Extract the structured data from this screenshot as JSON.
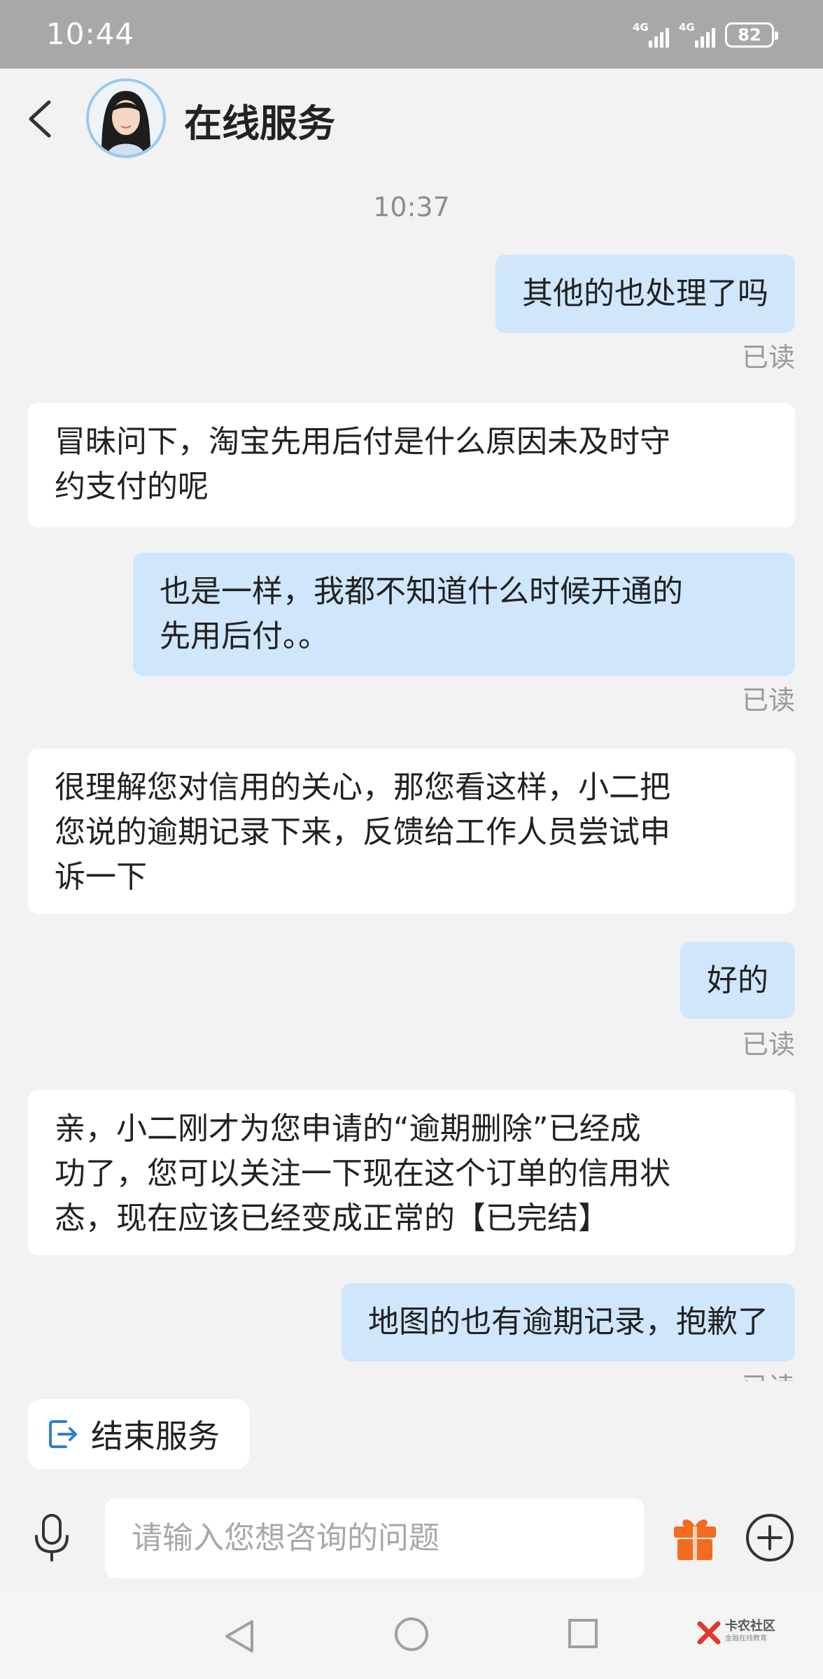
{
  "status_bar": {
    "time": "10:44",
    "signal1_label": "4G",
    "signal2_label": "4G",
    "battery": "82"
  },
  "header": {
    "title": "在线服务"
  },
  "chat": {
    "timestamp": "10:37",
    "messages": [
      {
        "from": "user",
        "text": "其他的也处理了吗",
        "status": "已读"
      },
      {
        "from": "agent",
        "lines": [
          "冒昧问下，淘宝先用后付是什么原因未及时守",
          "约支付的呢"
        ]
      },
      {
        "from": "user",
        "lines": [
          "也是一样，我都不知道什么时候开通的",
          "先用后付。。"
        ],
        "status": "已读"
      },
      {
        "from": "agent",
        "lines": [
          "很理解您对信用的关心，那您看这样，小二把",
          "您说的逾期记录下来，反馈给工作人员尝试申",
          "诉一下"
        ]
      },
      {
        "from": "user",
        "text": "好的",
        "status": "已读"
      },
      {
        "from": "agent",
        "lines": [
          "亲，小二刚才为您申请的“逾期删除”已经成",
          "功了，您可以关注一下现在这个订单的信用状",
          "态，现在应该已经变成正常的【已完结】"
        ]
      },
      {
        "from": "user",
        "text": "地图的也有逾期记录，抱歉了",
        "status": "已读"
      }
    ]
  },
  "actions": {
    "end_service_label": "结束服务"
  },
  "input": {
    "placeholder": "请输入您想咨询的问题"
  },
  "watermark": {
    "title": "卡农社区",
    "subtitle": "金融在线教育"
  },
  "colors": {
    "user_bubble": "#cfe6fd",
    "agent_bubble": "#ffffff",
    "accent_blue": "#2f7fd8",
    "gift_orange": "#f36b21"
  }
}
